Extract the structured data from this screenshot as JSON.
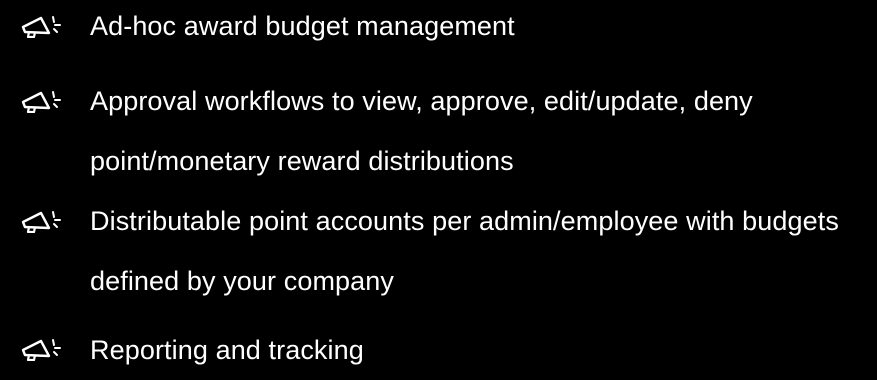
{
  "features": {
    "icon": "megaphone-icon",
    "items": [
      {
        "label": "Ad-hoc award budget management"
      },
      {
        "label": "Approval workflows to view, approve, edit/update, deny point/monetary reward distributions"
      },
      {
        "label": "Distributable point accounts per admin/employee with budgets defined by your company"
      },
      {
        "label": "Reporting and tracking"
      }
    ]
  },
  "colors": {
    "background": "#000000",
    "text": "#ffffff",
    "icon": "#ffffff"
  }
}
